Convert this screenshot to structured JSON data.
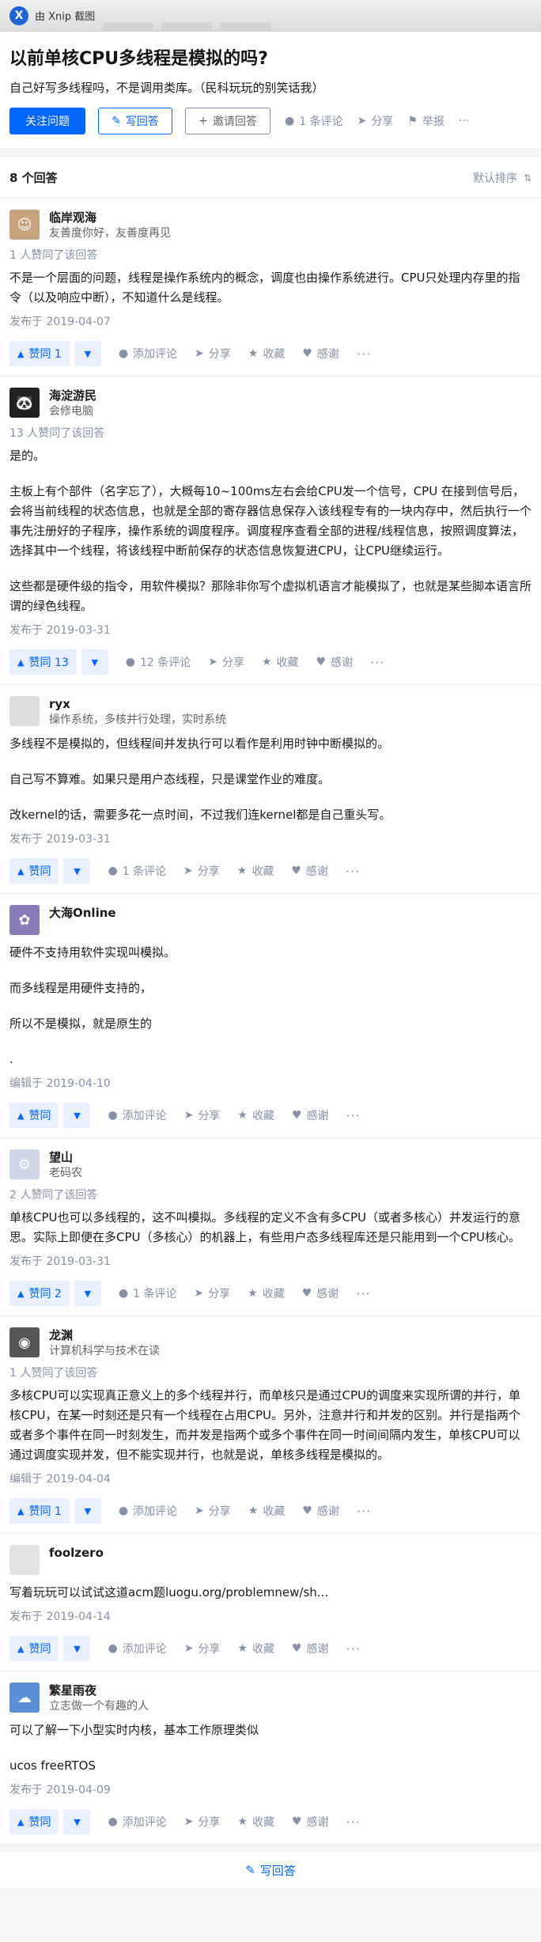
{
  "capture": {
    "logo": "X",
    "text": "由 Xnip 截图"
  },
  "question": {
    "title": "以前单核CPU多线程是模拟的吗?",
    "detail": "自己好写多线程吗，不是调用类库。（民科玩玩的别笑话我）",
    "follow_label": "关注问题",
    "write_label": "写回答",
    "invite_label": "邀请回答",
    "comment_label": "1 条评论",
    "share_label": "分享",
    "report_label": "举报",
    "more_label": "···"
  },
  "answers_header": {
    "count": "8 个回答",
    "sort": "默认排序"
  },
  "labels": {
    "add_comment": "添加评论",
    "share": "分享",
    "collect": "收藏",
    "thanks": "感谢",
    "more": "···",
    "upvote": "赞同"
  },
  "answers": [
    {
      "name": "临岸观海",
      "bio": "友善度你好，友善度再见",
      "votes_line": "1 人赞同了该回答",
      "paragraphs": [
        "不是一个层面的问题，线程是操作系统内的概念，调度也由操作系统进行。CPU只处理内存里的指令（以及响应中断），不知道什么是线程。"
      ],
      "date": "发布于 2019-04-07",
      "vote": "赞同 1",
      "comments": "添加评论"
    },
    {
      "name": "海淀游民",
      "bio": "会修电脑",
      "votes_line": "13 人赞同了该回答",
      "paragraphs": [
        "是的。",
        "主板上有个部件（名字忘了），大概每10~100ms左右会给CPU发一个信号，CPU 在接到信号后，会将当前线程的状态信息，也就是全部的寄存器信息保存入该线程专有的一块内存中，然后执行一个事先注册好的子程序，操作系统的调度程序。调度程序查看全部的进程/线程信息，按照调度算法，选择其中一个线程，将该线程中断前保存的状态信息恢复进CPU，让CPU继续运行。",
        "这些都是硬件级的指令，用软件模拟？那除非你写个虚拟机语言才能模拟了，也就是某些脚本语言所谓的绿色线程。"
      ],
      "date": "发布于 2019-03-31",
      "vote": "赞同 13",
      "comments": "12 条评论"
    },
    {
      "name": "ryx",
      "bio": "操作系统，多核并行处理，实时系统",
      "votes_line": "",
      "paragraphs": [
        "多线程不是模拟的，但线程间并发执行可以看作是利用时钟中断模拟的。",
        "自己写不算难。如果只是用户态线程，只是课堂作业的难度。",
        "改kernel的话，需要多花一点时间，不过我们连kernel都是自己重头写。"
      ],
      "date": "发布于 2019-03-31",
      "vote": "赞同",
      "comments": "1 条评论"
    },
    {
      "name": "大海Online",
      "bio": "",
      "votes_line": "",
      "paragraphs": [
        "硬件不支持用软件实现叫模拟。",
        "而多线程是用硬件支持的，",
        "所以不是模拟，就是原生的",
        "."
      ],
      "date": "编辑于 2019-04-10",
      "vote": "赞同",
      "comments": "添加评论"
    },
    {
      "name": "望山",
      "bio": "老码农",
      "votes_line": "2 人赞同了该回答",
      "paragraphs": [
        "单核CPU也可以多线程的，这不叫模拟。多线程的定义不含有多CPU（或者多核心）并发运行的意思。实际上即便在多CPU（多核心）的机器上，有些用户态多线程库还是只能用到一个CPU核心。"
      ],
      "date": "发布于 2019-03-31",
      "vote": "赞同 2",
      "comments": "1 条评论"
    },
    {
      "name": "龙渊",
      "bio": "计算机科学与技术在读",
      "votes_line": "1 人赞同了该回答",
      "paragraphs": [
        "多核CPU可以实现真正意义上的多个线程并行，而单核只是通过CPU的调度来实现所谓的并行，单核CPU，在某一时刻还是只有一个线程在占用CPU。另外，注意并行和并发的区别。并行是指两个或者多个事件在同一时刻发生，而并发是指两个或多个事件在同一时间间隔内发生，单核CPU可以通过调度实现并发，但不能实现并行，也就是说，单核多线程是模拟的。"
      ],
      "date": "编辑于 2019-04-04",
      "vote": "赞同 1",
      "comments": "添加评论"
    },
    {
      "name": "foolzero",
      "bio": "",
      "votes_line": "",
      "paragraphs": [
        "写着玩玩可以试试这道acm题luogu.org/problemnew/sh..."
      ],
      "date": "发布于 2019-04-14",
      "vote": "赞同",
      "comments": "添加评论"
    },
    {
      "name": "繁星雨夜",
      "bio": "立志做一个有趣的人",
      "votes_line": "",
      "paragraphs": [
        "可以了解一下小型实时内核，基本工作原理类似",
        "ucos freeRTOS"
      ],
      "date": "发布于 2019-04-09",
      "vote": "赞同",
      "comments": "添加评论"
    }
  ],
  "bottom": {
    "write_label": "写回答"
  },
  "colors": {
    "brand": "#0066ff",
    "muted": "#8590a6",
    "vote_bg": "#e8f0ff"
  }
}
